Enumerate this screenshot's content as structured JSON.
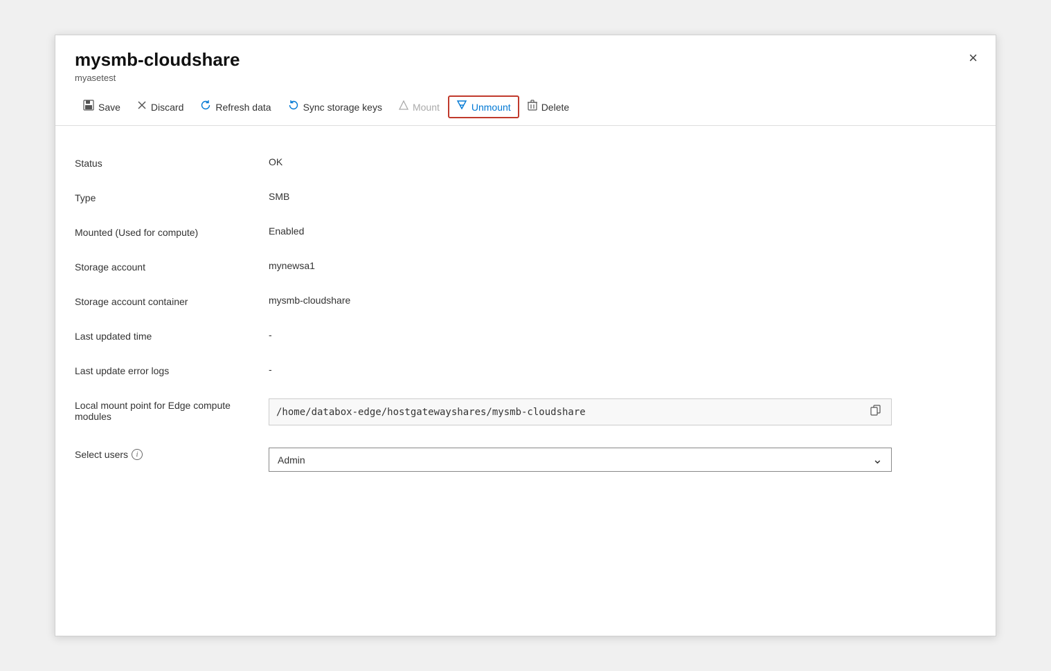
{
  "panel": {
    "title": "mysmb-cloudshare",
    "subtitle": "myasetest",
    "close_label": "×"
  },
  "toolbar": {
    "save_label": "Save",
    "discard_label": "Discard",
    "refresh_label": "Refresh data",
    "sync_label": "Sync storage keys",
    "mount_label": "Mount",
    "unmount_label": "Unmount",
    "delete_label": "Delete"
  },
  "fields": [
    {
      "label": "Status",
      "value": "OK"
    },
    {
      "label": "Type",
      "value": "SMB"
    },
    {
      "label": "Mounted (Used for compute)",
      "value": "Enabled"
    },
    {
      "label": "Storage account",
      "value": "mynewsa1"
    },
    {
      "label": "Storage account container",
      "value": "mysmb-cloudshare"
    },
    {
      "label": "Last updated time",
      "value": "-"
    },
    {
      "label": "Last update error logs",
      "value": "-"
    }
  ],
  "mount_point": {
    "label": "Local mount point for Edge compute modules",
    "value": "/home/databox-edge/hostgatewayshares/mysmb-cloudshare"
  },
  "select_users": {
    "label": "Select users",
    "value": "Admin",
    "info_tooltip": "Information"
  }
}
